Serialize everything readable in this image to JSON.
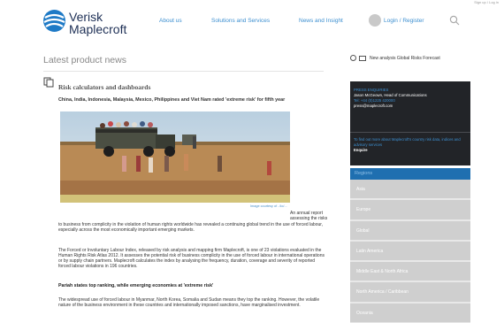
{
  "header": {
    "topright_text": "Sign up / Log in",
    "logo_line1": "Verisk",
    "logo_line2": "Maplecroft",
    "nav": [
      {
        "label": "About us"
      },
      {
        "label": "Solutions and Services"
      },
      {
        "label": "News and Insight"
      },
      {
        "label": "Login / Register"
      }
    ],
    "icons": {
      "search": "search-icon",
      "user": "avatar-icon"
    }
  },
  "main": {
    "page_title": "Latest product news",
    "section_heading": "Risk calculators and dashboards",
    "lead": "China, India, Indonesia, Malaysia, Mexico, Philippines and Viet Nam rated 'extreme risk' for fifth year",
    "image_caption": "Image courtesy of - ilo/...",
    "intro_fragment": "An annual report assessing the risks",
    "paragraph1": "to business from complicity in the violation of human rights worldwide has revealed a continuing global trend in the use of forced labour, especially across the most economically important emerging markets.",
    "paragraph2": "The Forced or Involuntary Labour Index, released by risk analysis and mapping firm Maplecroft, is one of 23 violations evaluated in the Human Rights Risk Atlas 2012. It assesses the potential risk of business complicity in the use of forced labour in international operations or by supply chain partners. Maplecroft calculates the index by analysing the frequency, duration, coverage and severity of reported forced labour violations in 196 countries.",
    "subheading": "Pariah states top ranking, while emerging economies at 'extreme risk'",
    "paragraph3": "The widespread use of forced labour in Myanmar, North Korea, Somalia and Sudan means they top the ranking. However, the volatile nature of the business environment in these countries and internationally imposed sanctions, have marginalised investment."
  },
  "sidebar": {
    "analysis_link": "New analysis Global Risks Forecast",
    "press": {
      "title": "PRESS ENQUIRIES",
      "name": "Jason McGeown, Head of Communications",
      "phone": "Tel: +44 (0)1225 420000",
      "email": "press@maplecroft.com"
    },
    "enquire": {
      "text": "To find out more about Maplecroft's country risk data, indices and advisory services",
      "button": "Enquire"
    },
    "regions": {
      "title": "Regions",
      "items": [
        "Asia",
        "Europe",
        "Global",
        "Latin America",
        "Middle East & North Africa",
        "North America / Caribbean",
        "Oceania"
      ]
    }
  },
  "colors": {
    "accent": "#3c8fd0",
    "brand_navy": "#1d2f55",
    "dark_panel": "#222428",
    "region_blue": "#1f6fb0"
  }
}
